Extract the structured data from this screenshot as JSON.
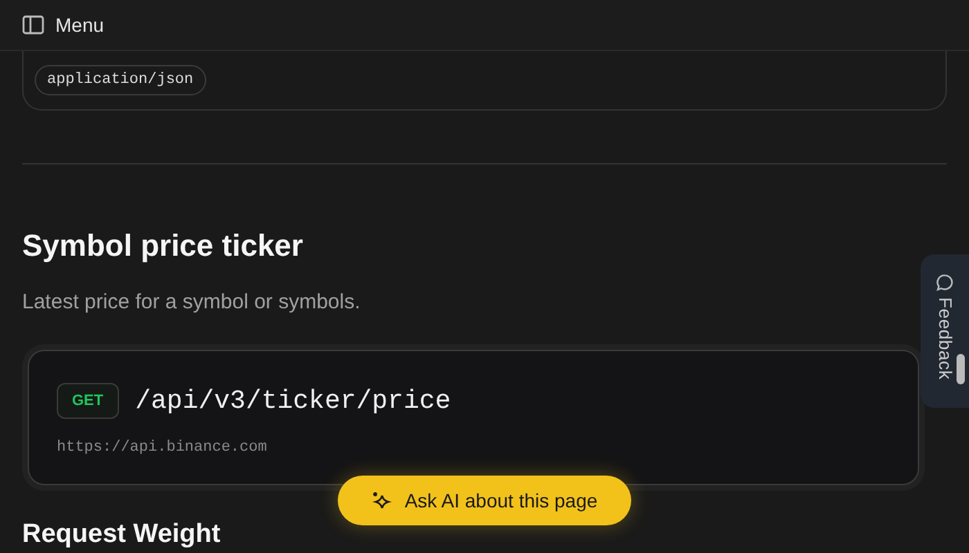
{
  "header": {
    "menu_label": "Menu"
  },
  "previous_card": {
    "content_type": "application/json"
  },
  "section": {
    "title": "Symbol price ticker",
    "description": "Latest price for a symbol or symbols."
  },
  "endpoint": {
    "method": "GET",
    "path": "/api/v3/ticker/price",
    "base_url": "https://api.binance.com"
  },
  "next_heading": "Request Weight",
  "feedback_tab": {
    "label": "Feedback"
  },
  "ask_ai_button": {
    "label": "Ask AI about this page"
  }
}
